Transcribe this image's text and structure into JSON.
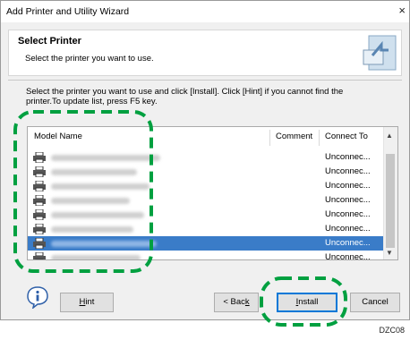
{
  "window": {
    "title": "Add Printer and Utility Wizard",
    "close_glyph": "×"
  },
  "header": {
    "title": "Select Printer",
    "subtitle": "Select the printer you want to use."
  },
  "instructions": {
    "line1": "Select the printer you want to use and click [Install]. Click [Hint] if you cannot find the",
    "line2": "printer.To update list, press F5 key."
  },
  "list": {
    "columns": [
      "Model Name",
      "Comment",
      "Connect To"
    ],
    "rows": [
      {
        "connect_to": "Unconnec...",
        "selected": false
      },
      {
        "connect_to": "Unconnec...",
        "selected": false
      },
      {
        "connect_to": "Unconnec...",
        "selected": false
      },
      {
        "connect_to": "Unconnec...",
        "selected": false
      },
      {
        "connect_to": "Unconnec...",
        "selected": false
      },
      {
        "connect_to": "Unconnec...",
        "selected": false
      },
      {
        "connect_to": "Unconnec...",
        "selected": true
      },
      {
        "connect_to": "Unconnec...",
        "selected": false
      }
    ]
  },
  "buttons": {
    "hint_mnemonic": "H",
    "hint_rest": "int",
    "back_prefix": "< Bac",
    "back_mnemonic": "k",
    "install_mnemonic": "I",
    "install_rest": "nstall",
    "cancel": "Cancel"
  },
  "icons": {
    "info": "info-icon",
    "printer": "printer-icon",
    "wizard": "wizard-icon"
  },
  "colors": {
    "selection": "#3a7cc8",
    "highlight_dash": "#00a040",
    "default_button_border": "#0078d7"
  },
  "caption": "DZC08"
}
